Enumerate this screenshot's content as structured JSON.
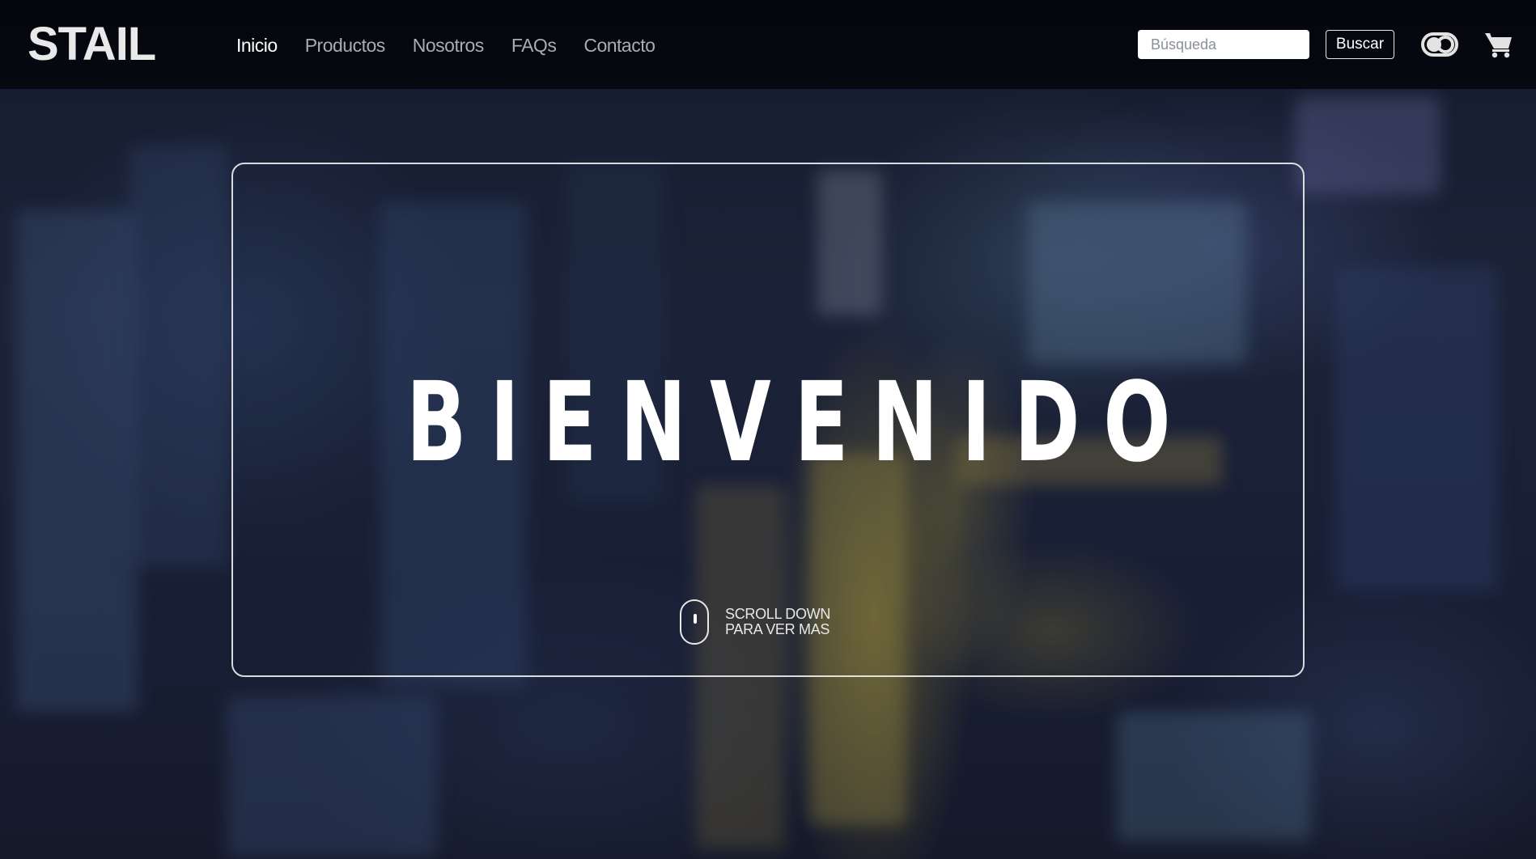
{
  "header": {
    "brand": "STAIL",
    "nav": [
      {
        "label": "Inicio",
        "active": true
      },
      {
        "label": "Productos",
        "active": false
      },
      {
        "label": "Nosotros",
        "active": false
      },
      {
        "label": "FAQs",
        "active": false
      },
      {
        "label": "Contacto",
        "active": false
      }
    ],
    "search": {
      "placeholder": "Búsqueda",
      "value": "",
      "button_label": "Buscar"
    },
    "icons": {
      "theme_toggle": "toggle-icon",
      "cart": "shopping-cart-icon"
    }
  },
  "hero": {
    "title": "BIENVENIDO",
    "scroll_line1": "SCROLL DOWN",
    "scroll_line2": "PARA VER MAS",
    "scroll_icon": "mouse-icon"
  },
  "colors": {
    "navbar_bg": "#05070d",
    "nav_active": "#ffffff",
    "nav_inactive": "#a9acb2",
    "card_border": "#f0f0f0"
  }
}
